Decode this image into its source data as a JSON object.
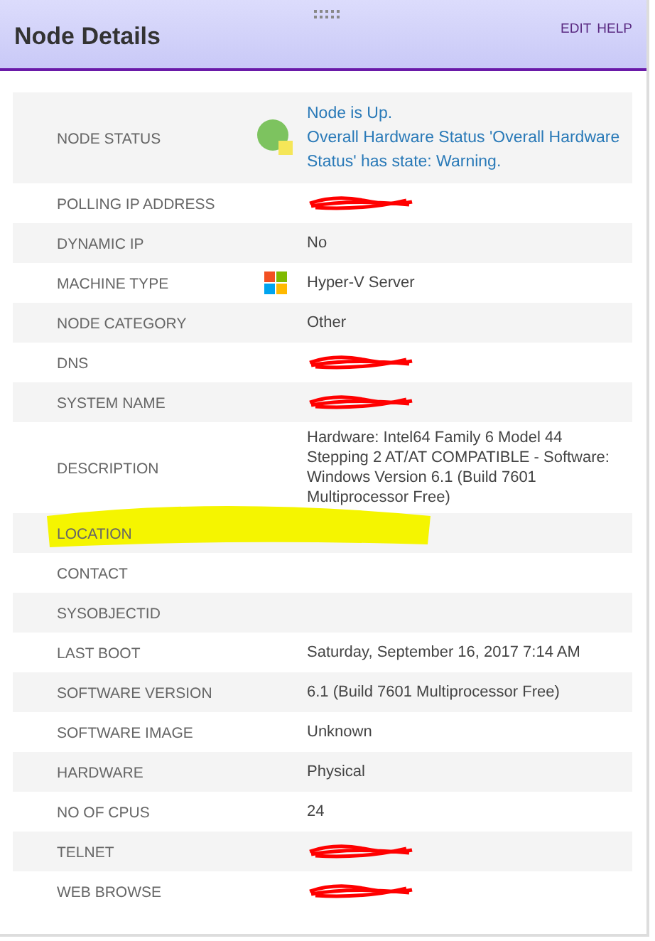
{
  "header": {
    "title": "Node Details",
    "actions": [
      "EDIT",
      "HELP"
    ]
  },
  "rows": [
    {
      "label": "NODE STATUS",
      "kind": "status",
      "values": [
        "Node is Up.",
        "Overall Hardware Status 'Overall Hardware Status' has state: Warning."
      ]
    },
    {
      "label": "POLLING IP ADDRESS",
      "kind": "redacted"
    },
    {
      "label": "DYNAMIC IP",
      "kind": "text",
      "value": "No"
    },
    {
      "label": "MACHINE TYPE",
      "kind": "os",
      "value": "Hyper-V Server"
    },
    {
      "label": "NODE CATEGORY",
      "kind": "text",
      "value": "Other"
    },
    {
      "label": "DNS",
      "kind": "redacted"
    },
    {
      "label": "SYSTEM NAME",
      "kind": "redacted"
    },
    {
      "label": "DESCRIPTION",
      "kind": "text",
      "value": "Hardware: Intel64 Family 6 Model 44 Stepping 2 AT/AT COMPATIBLE - Software: Windows Version 6.1 (Build 7601 Multiprocessor Free)"
    },
    {
      "label": "LOCATION",
      "highlighted": true,
      "kind": "empty"
    },
    {
      "label": "CONTACT",
      "kind": "empty"
    },
    {
      "label": "SYSOBJECTID",
      "kind": "empty"
    },
    {
      "label": "LAST BOOT",
      "kind": "text",
      "value": "Saturday, September 16, 2017 7:14 AM"
    },
    {
      "label": "SOFTWARE VERSION",
      "kind": "text",
      "value": "6.1 (Build 7601 Multiprocessor Free)"
    },
    {
      "label": "SOFTWARE IMAGE",
      "kind": "text",
      "value": "Unknown"
    },
    {
      "label": "HARDWARE",
      "kind": "text",
      "value": "Physical"
    },
    {
      "label": "NO OF CPUS",
      "kind": "text",
      "value": "24"
    },
    {
      "label": "TELNET",
      "kind": "redacted"
    },
    {
      "label": "WEB BROWSE",
      "kind": "redacted"
    }
  ]
}
